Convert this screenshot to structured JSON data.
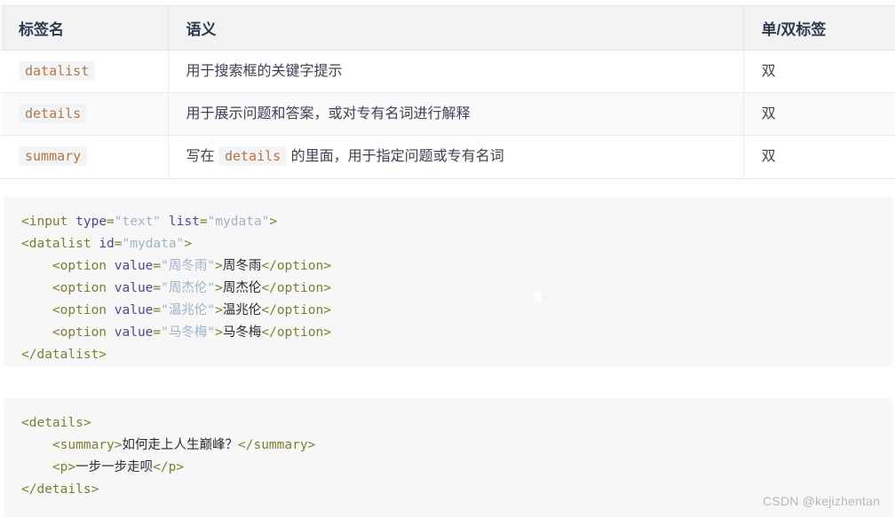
{
  "table": {
    "headers": [
      "标签名",
      "语义",
      "单/双标签"
    ],
    "rows": [
      {
        "tag": "datalist",
        "semantic_pre": "用于搜索框的关键字提示",
        "semantic_code": "",
        "semantic_post": "",
        "type": "双"
      },
      {
        "tag": "details",
        "semantic_pre": "用于展示问题和答案，或对专有名词进行解释",
        "semantic_code": "",
        "semantic_post": "",
        "type": "双"
      },
      {
        "tag": "summary",
        "semantic_pre": "写在 ",
        "semantic_code": "details",
        "semantic_post": " 的里面，用于指定问题或专有名词",
        "type": "双"
      }
    ]
  },
  "code_block_1": {
    "lines": [
      [
        {
          "t": "tag",
          "s": "<input"
        },
        {
          "t": "plain",
          "s": " "
        },
        {
          "t": "attr",
          "s": "type"
        },
        {
          "t": "punct",
          "s": "="
        },
        {
          "t": "str",
          "s": "\"text\""
        },
        {
          "t": "plain",
          "s": " "
        },
        {
          "t": "attr",
          "s": "list"
        },
        {
          "t": "punct",
          "s": "="
        },
        {
          "t": "str",
          "s": "\"mydata\""
        },
        {
          "t": "tag",
          "s": ">"
        }
      ],
      [
        {
          "t": "tag",
          "s": "<datalist"
        },
        {
          "t": "plain",
          "s": " "
        },
        {
          "t": "attr",
          "s": "id"
        },
        {
          "t": "punct",
          "s": "="
        },
        {
          "t": "str",
          "s": "\"mydata\""
        },
        {
          "t": "tag",
          "s": ">"
        }
      ],
      [
        {
          "t": "plain",
          "s": "    "
        },
        {
          "t": "tag",
          "s": "<option"
        },
        {
          "t": "plain",
          "s": " "
        },
        {
          "t": "attr",
          "s": "value"
        },
        {
          "t": "punct",
          "s": "="
        },
        {
          "t": "str",
          "s": "\"周冬雨\""
        },
        {
          "t": "tag",
          "s": ">"
        },
        {
          "t": "text",
          "s": "周冬雨"
        },
        {
          "t": "tag",
          "s": "</option>"
        }
      ],
      [
        {
          "t": "plain",
          "s": "    "
        },
        {
          "t": "tag",
          "s": "<option"
        },
        {
          "t": "plain",
          "s": " "
        },
        {
          "t": "attr",
          "s": "value"
        },
        {
          "t": "punct",
          "s": "="
        },
        {
          "t": "str",
          "s": "\"周杰伦\""
        },
        {
          "t": "tag",
          "s": ">"
        },
        {
          "t": "text",
          "s": "周杰伦"
        },
        {
          "t": "tag",
          "s": "</option>"
        }
      ],
      [
        {
          "t": "plain",
          "s": "    "
        },
        {
          "t": "tag",
          "s": "<option"
        },
        {
          "t": "plain",
          "s": " "
        },
        {
          "t": "attr",
          "s": "value"
        },
        {
          "t": "punct",
          "s": "="
        },
        {
          "t": "str",
          "s": "\"温兆伦\""
        },
        {
          "t": "tag",
          "s": ">"
        },
        {
          "t": "text",
          "s": "温兆伦"
        },
        {
          "t": "tag",
          "s": "</option>"
        }
      ],
      [
        {
          "t": "plain",
          "s": "    "
        },
        {
          "t": "tag",
          "s": "<option"
        },
        {
          "t": "plain",
          "s": " "
        },
        {
          "t": "attr",
          "s": "value"
        },
        {
          "t": "punct",
          "s": "="
        },
        {
          "t": "str",
          "s": "\"马冬梅\""
        },
        {
          "t": "tag",
          "s": ">"
        },
        {
          "t": "text",
          "s": "马冬梅"
        },
        {
          "t": "tag",
          "s": "</option>"
        }
      ],
      [
        {
          "t": "tag",
          "s": "</datalist>"
        }
      ]
    ]
  },
  "code_block_2": {
    "lines": [
      [
        {
          "t": "tag",
          "s": "<details>"
        }
      ],
      [
        {
          "t": "plain",
          "s": "    "
        },
        {
          "t": "tag",
          "s": "<summary>"
        },
        {
          "t": "text",
          "s": "如何走上人生巅峰？"
        },
        {
          "t": "tag",
          "s": "</summary>"
        }
      ],
      [
        {
          "t": "plain",
          "s": "    "
        },
        {
          "t": "tag",
          "s": "<p>"
        },
        {
          "t": "text",
          "s": "一步一步走呗"
        },
        {
          "t": "tag",
          "s": "</p>"
        }
      ],
      [
        {
          "t": "tag",
          "s": "</details>"
        }
      ]
    ]
  },
  "watermark": {
    "text": "CSDN @kejizhentan"
  },
  "colors": {
    "header_bg": "#f2f2f3",
    "header_text": "#2d3b52",
    "inline_code": "#b2754a",
    "inline_code_bg": "#f4f4f5",
    "code_bg": "#f7f7f8",
    "token_tag": "#7d7d33",
    "token_attr": "#4a4a8f",
    "token_string": "#9fb4c9",
    "watermark": "#b9b9bb"
  }
}
